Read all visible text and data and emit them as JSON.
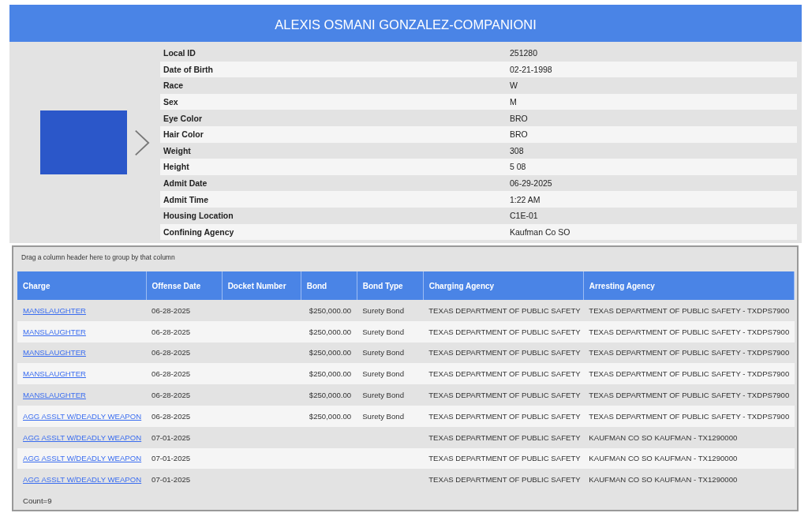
{
  "header": {
    "title": "ALEXIS OSMANI GONZALEZ-COMPANIONI"
  },
  "details": [
    {
      "label": "Local ID",
      "value": "251280"
    },
    {
      "label": "Date of Birth",
      "value": "02-21-1998"
    },
    {
      "label": "Race",
      "value": "W"
    },
    {
      "label": "Sex",
      "value": "M"
    },
    {
      "label": "Eye Color",
      "value": "BRO"
    },
    {
      "label": "Hair Color",
      "value": "BRO"
    },
    {
      "label": "Weight",
      "value": "308"
    },
    {
      "label": "Height",
      "value": "5 08"
    },
    {
      "label": "Admit Date",
      "value": "06-29-2025"
    },
    {
      "label": "Admit Time",
      "value": "1:22 AM"
    },
    {
      "label": "Housing Location",
      "value": "C1E-01"
    },
    {
      "label": "Confining Agency",
      "value": "Kaufman Co SO"
    }
  ],
  "grid": {
    "group_hint": "Drag a column header here to group by that column",
    "columns": [
      "Charge",
      "Offense Date",
      "Docket Number",
      "Bond",
      "Bond Type",
      "Charging Agency",
      "Arresting Agency"
    ],
    "rows": [
      [
        "MANSLAUGHTER",
        "06-28-2025",
        "",
        "$250,000.00",
        "Surety Bond",
        "TEXAS DEPARTMENT OF PUBLIC SAFETY",
        "TEXAS DEPARTMENT OF PUBLIC SAFETY - TXDPS7900"
      ],
      [
        "MANSLAUGHTER",
        "06-28-2025",
        "",
        "$250,000.00",
        "Surety Bond",
        "TEXAS DEPARTMENT OF PUBLIC SAFETY",
        "TEXAS DEPARTMENT OF PUBLIC SAFETY - TXDPS7900"
      ],
      [
        "MANSLAUGHTER",
        "06-28-2025",
        "",
        "$250,000.00",
        "Surety Bond",
        "TEXAS DEPARTMENT OF PUBLIC SAFETY",
        "TEXAS DEPARTMENT OF PUBLIC SAFETY - TXDPS7900"
      ],
      [
        "MANSLAUGHTER",
        "06-28-2025",
        "",
        "$250,000.00",
        "Surety Bond",
        "TEXAS DEPARTMENT OF PUBLIC SAFETY",
        "TEXAS DEPARTMENT OF PUBLIC SAFETY - TXDPS7900"
      ],
      [
        "MANSLAUGHTER",
        "06-28-2025",
        "",
        "$250,000.00",
        "Surety Bond",
        "TEXAS DEPARTMENT OF PUBLIC SAFETY",
        "TEXAS DEPARTMENT OF PUBLIC SAFETY - TXDPS7900"
      ],
      [
        "AGG ASSLT W/DEADLY WEAPON",
        "06-28-2025",
        "",
        "$250,000.00",
        "Surety Bond",
        "TEXAS DEPARTMENT OF PUBLIC SAFETY",
        "TEXAS DEPARTMENT OF PUBLIC SAFETY - TXDPS7900"
      ],
      [
        "AGG ASSLT W/DEADLY WEAPON",
        "07-01-2025",
        "",
        "",
        "",
        "TEXAS DEPARTMENT OF PUBLIC SAFETY",
        "KAUFMAN CO SO KAUFMAN - TX1290000"
      ],
      [
        "AGG ASSLT W/DEADLY WEAPON",
        "07-01-2025",
        "",
        "",
        "",
        "TEXAS DEPARTMENT OF PUBLIC SAFETY",
        "KAUFMAN CO SO KAUFMAN - TX1290000"
      ],
      [
        "AGG ASSLT W/DEADLY WEAPON",
        "07-01-2025",
        "",
        "",
        "",
        "TEXAS DEPARTMENT OF PUBLIC SAFETY",
        "KAUFMAN CO SO KAUFMAN - TX1290000"
      ]
    ],
    "footer": "Count=9"
  }
}
